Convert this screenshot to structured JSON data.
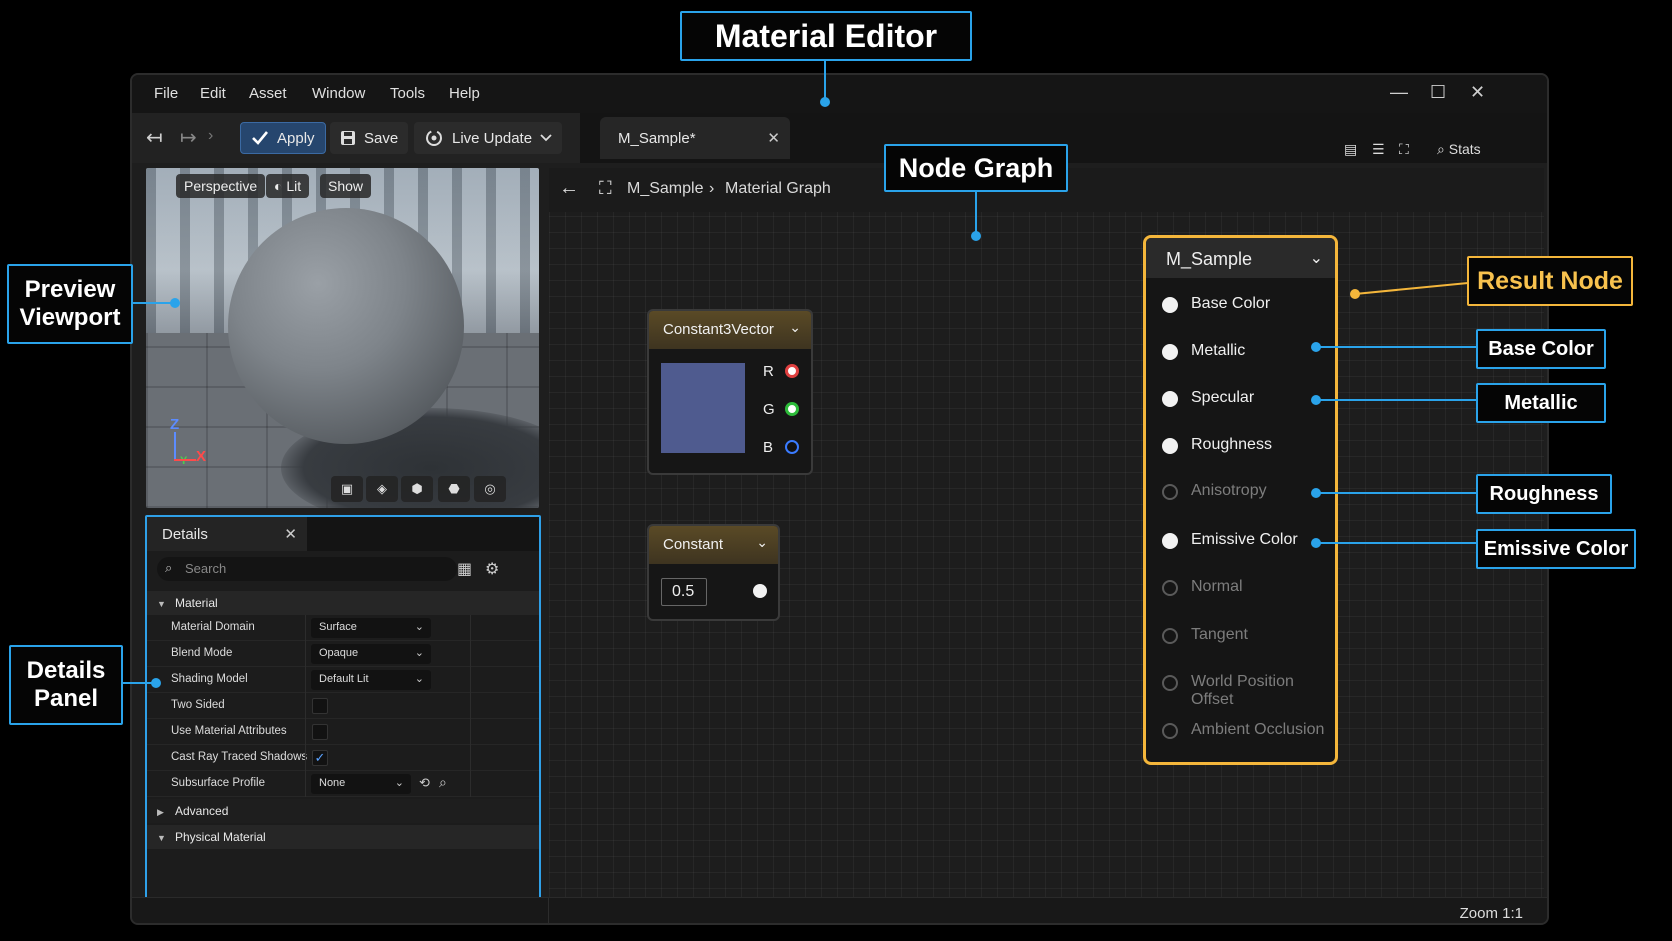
{
  "menu": [
    "File",
    "Edit",
    "Asset",
    "Window",
    "Tools",
    "Help"
  ],
  "window_controls": {
    "minimize": "—",
    "maximize": "☐",
    "close": "✕"
  },
  "toolbar": {
    "back": "↤",
    "forward": "↦",
    "more": "›",
    "apply_label": "Apply",
    "save_label": "Save",
    "live_update_label": "Live Update"
  },
  "tab": {
    "title": "M_Sample*",
    "close": "✕"
  },
  "viewport": {
    "perspective": "Perspective",
    "lit": "Lit",
    "show": "Show",
    "axis_z": "Z",
    "axis_x": "X",
    "axis_y": "Y"
  },
  "details": {
    "tab_title": "Details",
    "close": "✕",
    "search_placeholder": "Search",
    "sections": {
      "material": "Material",
      "advanced": "Advanced",
      "physical": "Physical Material"
    },
    "props": [
      {
        "label": "Material Domain",
        "value": "Surface"
      },
      {
        "label": "Blend Mode",
        "value": "Opaque"
      },
      {
        "label": "Shading Model",
        "value": "Default Lit"
      },
      {
        "label": "Two Sided",
        "checked": false
      },
      {
        "label": "Use Material Attributes",
        "checked": false
      },
      {
        "label": "Cast Ray Traced Shadows",
        "checked": true
      },
      {
        "label": "Subsurface Profile",
        "value": "None"
      }
    ]
  },
  "graph": {
    "breadcrumb_root": "M_Sample",
    "breadcrumb_sep": "›",
    "breadcrumb_child": "Material Graph",
    "stats": "Stats",
    "zoom": "Zoom 1:1"
  },
  "nodes": {
    "constant3vector": {
      "title": "Constant3Vector",
      "pins": [
        "R",
        "G",
        "B"
      ],
      "swatch_color": "#4f5b8f"
    },
    "constant": {
      "title": "Constant",
      "value": "0.5"
    }
  },
  "result": {
    "title": "M_Sample",
    "pins": [
      {
        "label": "Base Color",
        "active": true
      },
      {
        "label": "Metallic",
        "active": true
      },
      {
        "label": "Specular",
        "active": true
      },
      {
        "label": "Roughness",
        "active": true
      },
      {
        "label": "Anisotropy",
        "active": false
      },
      {
        "label": "Emissive Color",
        "active": true
      },
      {
        "label": "Normal",
        "active": false
      },
      {
        "label": "Tangent",
        "active": false
      },
      {
        "label": "World Position Offset",
        "active": false
      },
      {
        "label": "Ambient Occlusion",
        "active": false
      }
    ]
  },
  "callouts": {
    "material_editor": "Material Editor",
    "node_graph": "Node Graph",
    "preview_viewport_1": "Preview",
    "preview_viewport_2": "Viewport",
    "details_panel_1": "Details",
    "details_panel_2": "Panel",
    "result_node": "Result Node",
    "base_color": "Base Color",
    "metallic": "Metallic",
    "roughness": "Roughness",
    "emissive_color": "Emissive Color"
  },
  "colors": {
    "accent": "#2aa3ea",
    "result_outline": "#f4b63b",
    "apply_blue": "#26466e"
  }
}
